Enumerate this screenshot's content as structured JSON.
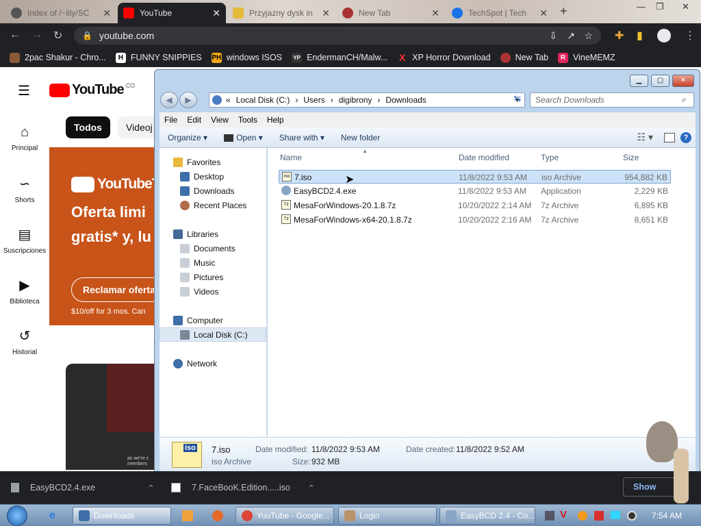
{
  "browser": {
    "tabs": [
      {
        "title": "Index of /~lily/SC",
        "active": false,
        "icon": "globe-icon"
      },
      {
        "title": "YouTube",
        "active": true,
        "icon": "youtube-icon"
      },
      {
        "title": "Przyjazny dysk in",
        "active": false,
        "icon": "folder-icon"
      },
      {
        "title": "New Tab",
        "active": false,
        "icon": "chrome-icon"
      },
      {
        "title": "TechSpot | Tech",
        "active": false,
        "icon": "techspot-icon"
      }
    ],
    "new_tab_symbol": "+",
    "address": "youtube.com",
    "bookmarks": [
      {
        "label": "2pac Shakur - Chro...",
        "icon": "bookmark-2pac-icon"
      },
      {
        "label": "FUNNY SNIPPIES",
        "icon_letter": "H"
      },
      {
        "label": "windows ISOS",
        "icon_letter": "PH"
      },
      {
        "label": "EndermanCH/Malw...",
        "icon_letter": "YP"
      },
      {
        "label": "XP Horror Download",
        "icon_letter": "X"
      },
      {
        "label": "New Tab",
        "icon": "chrome-icon"
      },
      {
        "label": "VineMEMZ",
        "icon_letter": "R"
      }
    ]
  },
  "youtube": {
    "logo_text": "YouTube",
    "country": "CO",
    "chips": [
      "Todos",
      "Videoj"
    ],
    "nav": [
      {
        "label": "Principal",
        "icon": "home-icon"
      },
      {
        "label": "Shorts",
        "icon": "shorts-icon"
      },
      {
        "label": "Suscripciones",
        "icon": "subscriptions-icon"
      },
      {
        "label": "Biblioteca",
        "icon": "library-icon"
      },
      {
        "label": "Historial",
        "icon": "history-icon"
      }
    ],
    "promo": {
      "logo_text": "YouTubeT",
      "headline1": "Oferta limi",
      "headline2": "gratis* y, lu",
      "button": "Reclamar oferta",
      "footnote": "$10/off for 3 mos. Can"
    },
    "video_caption": "as we're c members"
  },
  "explorer": {
    "breadcrumb": [
      "Local Disk (C:)",
      "Users",
      "digibrony",
      "Downloads"
    ],
    "breadcrumb_prefix": "«",
    "search_placeholder": "Search Downloads",
    "menu": [
      "File",
      "Edit",
      "View",
      "Tools",
      "Help"
    ],
    "commands": [
      "Organize",
      "Open",
      "Share with",
      "New folder"
    ],
    "nav": {
      "favorites": "Favorites",
      "favorite_items": [
        "Desktop",
        "Downloads",
        "Recent Places"
      ],
      "libraries": "Libraries",
      "library_items": [
        "Documents",
        "Music",
        "Pictures",
        "Videos"
      ],
      "computer": "Computer",
      "computer_items": [
        "Local Disk (C:)"
      ],
      "network": "Network"
    },
    "columns": [
      "Name",
      "Date modified",
      "Type",
      "Size"
    ],
    "files": [
      {
        "name": "7.iso",
        "date": "11/8/2022 9:53 AM",
        "type": "iso Archive",
        "size": "954,882 KB",
        "selected": true,
        "icon": "iso-icon"
      },
      {
        "name": "EasyBCD2.4.exe",
        "date": "11/8/2022 9:53 AM",
        "type": "Application",
        "size": "2,229 KB",
        "selected": false,
        "icon": "exe-icon"
      },
      {
        "name": "MesaForWindows-20.1.8.7z",
        "date": "10/20/2022 2:14 AM",
        "type": "7z Archive",
        "size": "6,895 KB",
        "selected": false,
        "icon": "archive-icon"
      },
      {
        "name": "MesaForWindows-x64-20.1.8.7z",
        "date": "10/20/2022 2:16 AM",
        "type": "7z Archive",
        "size": "8,651 KB",
        "selected": false,
        "icon": "archive-icon"
      }
    ],
    "details": {
      "name": "7.iso",
      "type": "iso Archive",
      "icon_text": "iso",
      "modified_label": "Date modified:",
      "modified": "11/8/2022 9:53 AM",
      "created_label": "Date created:",
      "created": "11/8/2022 9:52 AM",
      "size_label": "Size:",
      "size": "932 MB"
    }
  },
  "downloads_bar": [
    {
      "name": "EasyBCD2.4.exe"
    },
    {
      "name": "7.FaceBooK.Edition.....iso"
    }
  ],
  "downloads_show_button": "Show",
  "taskbar": {
    "items": [
      {
        "label": "Downloads",
        "active": true
      },
      {
        "label": "YouTube - Google..."
      },
      {
        "label": "Login"
      },
      {
        "label": "EasyBCD 2.4 - Co..."
      }
    ],
    "clock": "7:54 AM"
  },
  "colors": {
    "chrome_dark": "#202124",
    "youtube_red": "#ff0000",
    "promo_orange": "#c8541a",
    "selection": "#cce2f8",
    "aero_blue": "#bcd4ec"
  }
}
